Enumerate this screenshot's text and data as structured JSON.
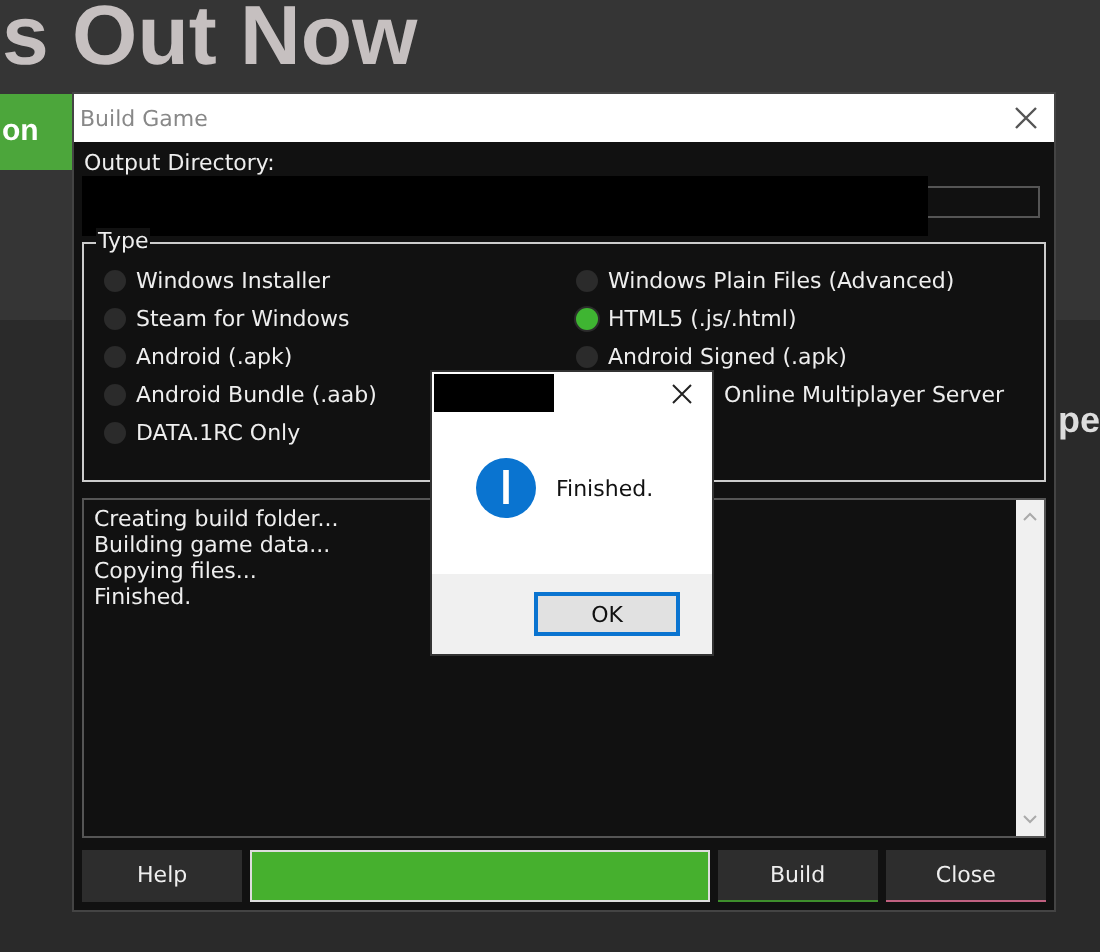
{
  "page": {
    "heading": "s Out Now",
    "button": "on",
    "side_text": "pe"
  },
  "window": {
    "title": "Build Game"
  },
  "output": {
    "label": "Output Directory:"
  },
  "type_group": {
    "title": "Type",
    "left_options": [
      {
        "label": "Windows Installer",
        "selected": false
      },
      {
        "label": "Steam for Windows",
        "selected": false
      },
      {
        "label": "Android (.apk)",
        "selected": false
      },
      {
        "label": "Android Bundle (.aab)",
        "selected": false
      },
      {
        "label": "DATA.1RC Only",
        "selected": false
      }
    ],
    "right_options": [
      {
        "label": "Windows Plain Files (Advanced)",
        "selected": false,
        "covered": false
      },
      {
        "label": "HTML5 (.js/.html)",
        "selected": true,
        "covered": false
      },
      {
        "label": "Android Signed (.apk)",
        "selected": false,
        "covered": false
      },
      {
        "label": "Online Multiplayer Server",
        "covered": true
      }
    ]
  },
  "log": {
    "lines": [
      "Creating build folder...",
      "Building game data...",
      "Copying files...",
      "Finished."
    ]
  },
  "footer": {
    "help": "Help",
    "progress": {
      "level": 1
    },
    "build": "Build",
    "close": "Close"
  },
  "message_box": {
    "message": "Finished.",
    "button": "OK"
  }
}
